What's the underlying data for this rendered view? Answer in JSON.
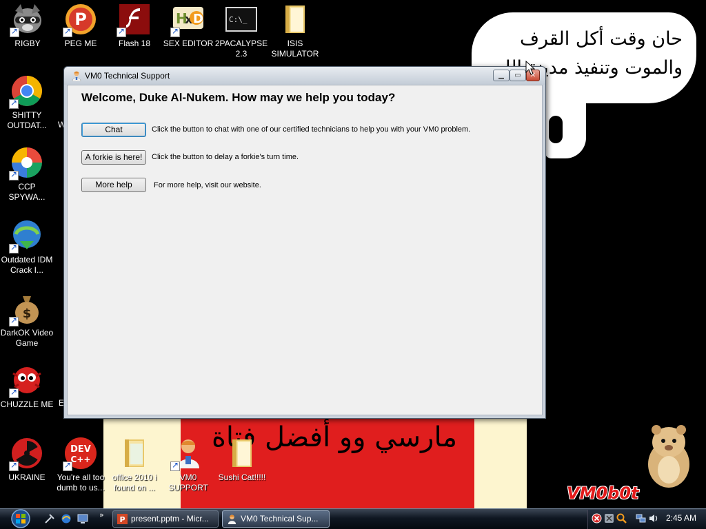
{
  "wallpaper": {
    "bubble_text": "حان وقت أكل القرف والموت وتنفيذ مدينة الله",
    "band_text": "مارسي وو أفضل فتاة",
    "logo_text": "VM0b0t"
  },
  "desktop_icons": [
    {
      "id": "rigby",
      "label": "RIGBY",
      "icon": "raccoon-icon"
    },
    {
      "id": "peg-me",
      "label": "PEG ME",
      "icon": "peg-me-icon"
    },
    {
      "id": "flash-18",
      "label": "Flash 18",
      "icon": "flash-icon"
    },
    {
      "id": "sex-editor",
      "label": "SEX EDITOR",
      "icon": "hxd-icon"
    },
    {
      "id": "2pacalypse",
      "label": "2PACALYPSE 2.3",
      "icon": "terminal-icon"
    },
    {
      "id": "isis-simulator",
      "label": "ISIS SIMULATOR",
      "icon": "folder-icon"
    },
    {
      "id": "shitty-outdated",
      "label": "SHITTY OUTDAT...",
      "icon": "chrome-icon"
    },
    {
      "id": "ccp-spyware",
      "label": "CCP SPYWA...",
      "icon": "pinwheel-icon"
    },
    {
      "id": "outdated-idm",
      "label": "Outdated IDM Crack I...",
      "icon": "idm-icon"
    },
    {
      "id": "darkok",
      "label": "DarkOK Video Game",
      "icon": "money-bag-icon"
    },
    {
      "id": "chuzzle",
      "label": "CHUZZLE ME",
      "icon": "chuzzle-icon"
    },
    {
      "id": "ukraine",
      "label": "UKRAINE",
      "icon": "radiation-icon"
    },
    {
      "id": "youre-dumb",
      "label": "You're all too dumb to us...",
      "icon": "dev-cpp-icon"
    },
    {
      "id": "office-2010",
      "label": "office 2010 i found on ...",
      "icon": "folder-icon"
    },
    {
      "id": "vm0-support",
      "label": "VM0 SUPPORT",
      "icon": "technician-icon"
    },
    {
      "id": "sushi-cat",
      "label": "Sushi Cat!!!!!",
      "icon": "folder-icon"
    }
  ],
  "partial_labels": {
    "w": "W",
    "e": "E"
  },
  "dialog": {
    "title": "VM0 Technical Support",
    "welcome": "Welcome, Duke Al-Nukem. How may we help you today?",
    "rows": [
      {
        "button": "Chat",
        "description": "Click the button to chat with one of our certified technicians to help you with your VM0 problem."
      },
      {
        "button": "A forkie is here!",
        "description": "Click the button to delay a forkie's turn time."
      },
      {
        "button": "More help",
        "description": "For more help, visit our website."
      }
    ]
  },
  "taskbar": {
    "tasks": [
      {
        "label": "present.pptm - Micr...",
        "icon": "powerpoint-icon"
      },
      {
        "label": "VM0 Technical Sup...",
        "icon": "technician-icon"
      }
    ],
    "quick_launch_more": "»",
    "clock": "2:45 AM"
  },
  "colors": {
    "accent_red": "#e01e1e",
    "taskbar": "#0f1722",
    "dialog_bg": "#f0f0f0"
  }
}
